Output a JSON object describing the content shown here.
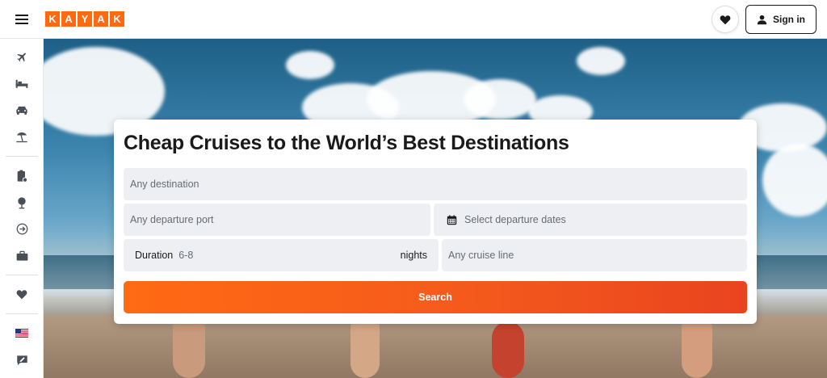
{
  "header": {
    "logo_letters": [
      "K",
      "A",
      "Y",
      "A",
      "K"
    ],
    "signin_label": "Sign in"
  },
  "sidebar": {
    "items": [
      {
        "icon": "plane-icon"
      },
      {
        "icon": "bed-icon"
      },
      {
        "icon": "car-icon"
      },
      {
        "icon": "beach-umbrella-icon"
      },
      {
        "icon": "clipboard-icon"
      },
      {
        "icon": "globe-icon"
      },
      {
        "icon": "explore-icon"
      },
      {
        "icon": "briefcase-icon"
      },
      {
        "icon": "heart-icon"
      },
      {
        "icon": "us-flag-icon"
      },
      {
        "icon": "feedback-icon"
      }
    ]
  },
  "search": {
    "title": "Cheap Cruises to the World’s Best Destinations",
    "destination_placeholder": "Any destination",
    "departure_port_placeholder": "Any departure port",
    "dates_placeholder": "Select departure dates",
    "duration_label": "Duration",
    "duration_value": "6-8",
    "duration_unit": "nights",
    "cruise_line_placeholder": "Any cruise line",
    "search_label": "Search"
  },
  "colors": {
    "brand": "#ff690f",
    "search_button": "#f55a1c"
  }
}
